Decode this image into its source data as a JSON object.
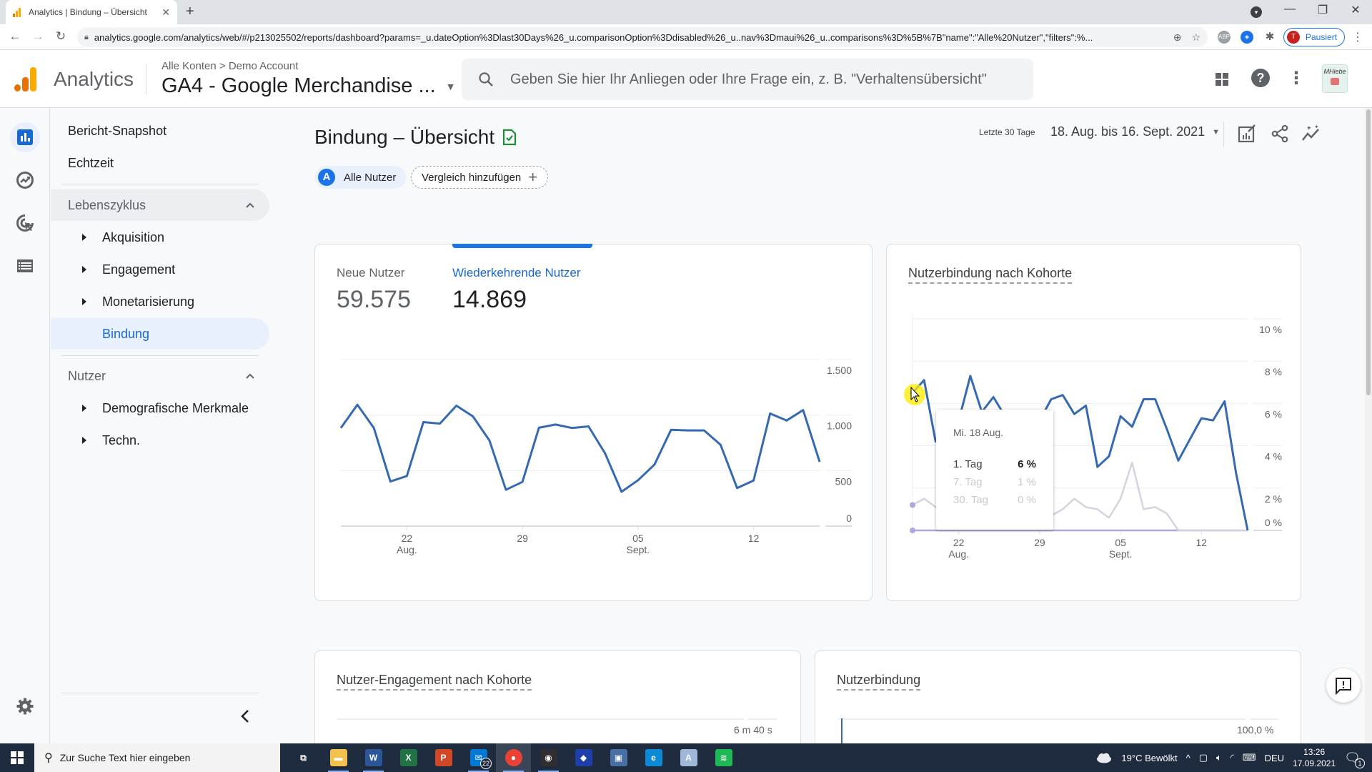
{
  "browser": {
    "tab_title": "Analytics | Bindung – Übersicht",
    "url": "analytics.google.com/analytics/web/#/p213025502/reports/dashboard?params=_u.dateOption%3Dlast30Days%26_u.comparisonOption%3Ddisabled%26_u..nav%3Dmaui%26_u..comparisons%3D%5B%7B\"name\":\"Alle%20Nutzer\",\"filters\":%...",
    "profile_initial": "T",
    "profile_status": "Pausiert"
  },
  "header": {
    "app_name": "Analytics",
    "breadcrumb": "Alle Konten > Demo Account",
    "property": "GA4 - Google Merchandise ...",
    "search_placeholder": "Geben Sie hier Ihr Anliegen oder Ihre Frage ein, z. B. \"Verhaltensübersicht\"",
    "avatar_text": "MHiebe"
  },
  "sidebar": {
    "top_items": [
      {
        "label": "Bericht-Snapshot"
      },
      {
        "label": "Echtzeit"
      }
    ],
    "sections": [
      {
        "label": "Lebenszyklus",
        "items": [
          {
            "label": "Akquisition",
            "expandable": true
          },
          {
            "label": "Engagement",
            "expandable": true
          },
          {
            "label": "Monetarisierung",
            "expandable": true
          },
          {
            "label": "Bindung",
            "expandable": false,
            "active": true
          }
        ]
      },
      {
        "label": "Nutzer",
        "items": [
          {
            "label": "Demografische Merkmale",
            "expandable": true
          },
          {
            "label": "Techn.",
            "expandable": true
          }
        ]
      }
    ]
  },
  "page": {
    "title": "Bindung – Übersicht",
    "segment_chip": {
      "letter": "A",
      "label": "Alle Nutzer"
    },
    "compare_label": "Vergleich hinzufügen",
    "date_label": "Letzte 30 Tage",
    "date_range": "18. Aug. bis 16. Sept. 2021"
  },
  "cards": {
    "users": {
      "metrics": [
        {
          "label": "Neue Nutzer",
          "value": "59.575"
        },
        {
          "label": "Wiederkehrende Nutzer",
          "value": "14.869",
          "active": true
        }
      ]
    },
    "cohort": {
      "title": "Nutzerbindung nach Kohorte",
      "tooltip": {
        "date": "Mi. 18 Aug.",
        "rows": [
          {
            "label": "1. Tag",
            "value": "6 %"
          },
          {
            "label": "7. Tag",
            "value": "1 %"
          },
          {
            "label": "30. Tag",
            "value": "0 %"
          }
        ]
      }
    },
    "engagement": {
      "title": "Nutzer-Engagement nach Kohorte",
      "axis_top": "6 m 40 s"
    },
    "retention": {
      "title": "Nutzerbindung",
      "axis_top": "100,0 %"
    }
  },
  "chart_data": [
    {
      "type": "line",
      "title": "Wiederkehrende Nutzer",
      "x": [
        "18.08",
        "19.08",
        "20.08",
        "21.08",
        "22.08",
        "23.08",
        "24.08",
        "25.08",
        "26.08",
        "27.08",
        "28.08",
        "29.08",
        "30.08",
        "31.08",
        "01.09",
        "02.09",
        "03.09",
        "04.09",
        "05.09",
        "06.09",
        "07.09",
        "08.09",
        "09.09",
        "10.09",
        "11.09",
        "12.09",
        "13.09",
        "14.09",
        "15.09",
        "16.09"
      ],
      "series": [
        {
          "name": "Wiederkehrende Nutzer",
          "color": "#3569b2",
          "values": [
            884,
            1093,
            884,
            402,
            451,
            937,
            923,
            1085,
            988,
            772,
            327,
            398,
            886,
            915,
            884,
            898,
            656,
            309,
            413,
            555,
            868,
            862,
            862,
            732,
            343,
            411,
            1014,
            951,
            1045,
            579
          ]
        }
      ],
      "ylim": [
        0,
        1500
      ],
      "yticks": [
        {
          "v": 0,
          "label": "0"
        },
        {
          "v": 500,
          "label": "500"
        },
        {
          "v": 1000,
          "label": "1.000"
        },
        {
          "v": 1500,
          "label": "1.500"
        }
      ],
      "xticks": [
        {
          "index": 4,
          "label": "22",
          "sub": "Aug."
        },
        {
          "index": 11,
          "label": "29",
          "sub": ""
        },
        {
          "index": 18,
          "label": "05",
          "sub": "Sept."
        },
        {
          "index": 25,
          "label": "12",
          "sub": ""
        }
      ],
      "grid": true
    },
    {
      "type": "line",
      "title": "Nutzerbindung nach Kohorte",
      "x": [
        "18.08",
        "19.08",
        "20.08",
        "21.08",
        "22.08",
        "23.08",
        "24.08",
        "25.08",
        "26.08",
        "27.08",
        "28.08",
        "29.08",
        "30.08",
        "31.08",
        "01.09",
        "02.09",
        "03.09",
        "04.09",
        "05.09",
        "06.09",
        "07.09",
        "08.09",
        "09.09",
        "10.09",
        "11.09",
        "12.09",
        "13.09",
        "14.09",
        "15.09",
        "16.09"
      ],
      "series": [
        {
          "name": "1. Tag",
          "color": "#3569b2",
          "values": [
            6.5,
            7.1,
            4.2,
            4.8,
            5.2,
            7.3,
            5.6,
            6.3,
            5.4,
            4.5,
            4.5,
            5.2,
            6.2,
            6.4,
            5.5,
            5.9,
            3.0,
            3.5,
            5.4,
            4.9,
            6.2,
            6.2,
            4.8,
            3.3,
            4.3,
            5.3,
            5.2,
            6.1,
            2.7,
            0
          ]
        },
        {
          "name": "7. Tag",
          "color": "#d5d3e0",
          "values": [
            1.2,
            1.5,
            1.1,
            0.9,
            0.8,
            1.0,
            1.2,
            1.0,
            0.8,
            0.7,
            0.6,
            0.5,
            0.7,
            1.0,
            1.5,
            1.1,
            1.0,
            0.6,
            1.5,
            3.2,
            1.0,
            1.1,
            0.8,
            0,
            0,
            0,
            0,
            0,
            0,
            0
          ]
        },
        {
          "name": "30. Tag",
          "color": "#b3a6df",
          "values": [
            0,
            0,
            0,
            0,
            0,
            0,
            0,
            0,
            0,
            0,
            0,
            0,
            0,
            0,
            0,
            0,
            0,
            0,
            0,
            0,
            0,
            0,
            0,
            0,
            0,
            0,
            0,
            0,
            0,
            0
          ]
        }
      ],
      "ylim": [
        0,
        10
      ],
      "yticks": [
        {
          "v": 0,
          "label": "0 %"
        },
        {
          "v": 2,
          "label": "2 %"
        },
        {
          "v": 4,
          "label": "4 %"
        },
        {
          "v": 6,
          "label": "6 %"
        },
        {
          "v": 8,
          "label": "8 %"
        },
        {
          "v": 10,
          "label": "10 %"
        }
      ],
      "xticks": [
        {
          "index": 4,
          "label": "22",
          "sub": "Aug."
        },
        {
          "index": 11,
          "label": "29",
          "sub": ""
        },
        {
          "index": 18,
          "label": "05",
          "sub": "Sept."
        },
        {
          "index": 25,
          "label": "12",
          "sub": ""
        }
      ],
      "grid": true
    }
  ],
  "taskbar": {
    "search_placeholder": "Zur Suche Text hier eingeben",
    "apps": [
      {
        "name": "task-view",
        "glyph": "⧉",
        "color": "transparent"
      },
      {
        "name": "file-explorer",
        "glyph": "▬",
        "color": "#f2c14e"
      },
      {
        "name": "word",
        "glyph": "W",
        "color": "#2b579a"
      },
      {
        "name": "excel",
        "glyph": "X",
        "color": "#217346"
      },
      {
        "name": "powerpoint",
        "glyph": "P",
        "color": "#d24726"
      },
      {
        "name": "mail",
        "glyph": "✉",
        "color": "#0078d4",
        "badge": "22"
      },
      {
        "name": "chrome",
        "glyph": "●",
        "color": "#ea4335"
      },
      {
        "name": "obs",
        "glyph": "◉",
        "color": "#302e31"
      },
      {
        "name": "app-blue",
        "glyph": "◆",
        "color": "#1c3faa"
      },
      {
        "name": "app-image",
        "glyph": "▣",
        "color": "#4a6fa5"
      },
      {
        "name": "edge",
        "glyph": "e",
        "color": "#0c8ad6"
      },
      {
        "name": "notepad",
        "glyph": "A",
        "color": "#9fb7d9"
      },
      {
        "name": "spotify",
        "glyph": "≋",
        "color": "#1db954"
      }
    ],
    "weather": "19°C  Bewölkt",
    "language": "DEU",
    "time": "13:26",
    "date": "17.09.2021",
    "notifications": "1"
  }
}
